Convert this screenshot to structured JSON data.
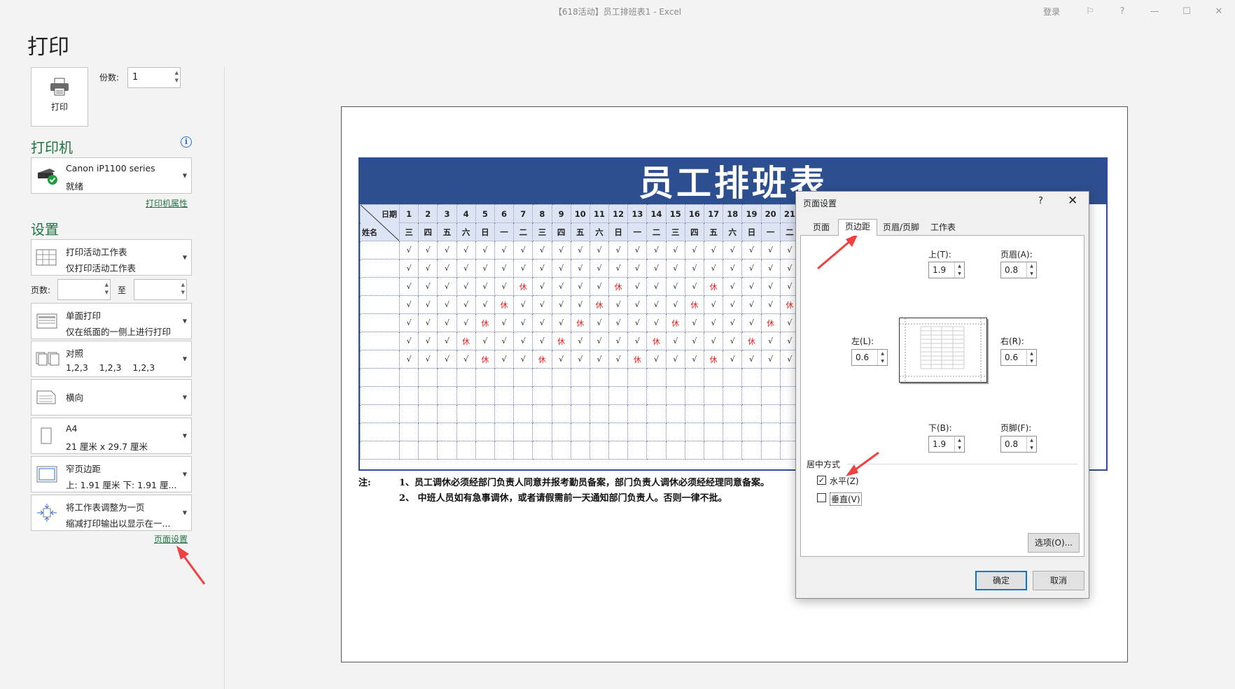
{
  "window": {
    "title": "【618活动】员工排班表1  -  Excel",
    "login": "登录"
  },
  "heading": "打印",
  "print_button": {
    "label": "打印"
  },
  "copies": {
    "label": "份数:",
    "value": "1"
  },
  "printer": {
    "section": "打印机",
    "name": "Canon iP1100 series",
    "status": "就绪",
    "properties_link": "打印机属性"
  },
  "settings": {
    "section": "设置",
    "items": [
      {
        "l1": "打印活动工作表",
        "l2": "仅打印活动工作表",
        "icon": "sheet-icon"
      },
      {
        "l1": "单面打印",
        "l2": "仅在纸面的一侧上进行打印",
        "icon": "one-sided-icon"
      },
      {
        "l1": "对照",
        "l2": "1,2,3    1,2,3    1,2,3",
        "icon": "collate-icon"
      },
      {
        "l1": "横向",
        "l2": "",
        "icon": "landscape-icon"
      },
      {
        "l1": "A4",
        "l2": "21 厘米 x 29.7 厘米",
        "icon": "paper-size-icon"
      },
      {
        "l1": "窄页边距",
        "l2": "上: 1.91 厘米 下: 1.91 厘...",
        "icon": "margins-icon"
      },
      {
        "l1": "将工作表调整为一页",
        "l2": "缩减打印输出以显示在一...",
        "icon": "scaling-icon"
      }
    ],
    "pages_label": "页数:",
    "to_label": "至",
    "page_setup_link": "页面设置"
  },
  "sheet": {
    "title": "员工排班表",
    "date_label": "日期",
    "name_label": "姓名",
    "days": [
      "1",
      "2",
      "3",
      "4",
      "5",
      "6",
      "7",
      "8",
      "9",
      "10",
      "11",
      "12",
      "13",
      "14",
      "15",
      "16",
      "17",
      "18",
      "19",
      "20",
      "21"
    ],
    "weekdays": [
      "三",
      "四",
      "五",
      "六",
      "日",
      "一",
      "二",
      "三",
      "四",
      "五",
      "六",
      "日",
      "一",
      "二",
      "三",
      "四",
      "五",
      "六",
      "日",
      "一",
      "二"
    ],
    "rows": [
      [
        "√",
        "√",
        "√",
        "√",
        "√",
        "√",
        "√",
        "√",
        "√",
        "√",
        "√",
        "√",
        "√",
        "√",
        "√",
        "√",
        "√",
        "√",
        "√",
        "√",
        "√"
      ],
      [
        "√",
        "√",
        "√",
        "√",
        "√",
        "√",
        "√",
        "√",
        "√",
        "√",
        "√",
        "√",
        "√",
        "√",
        "√",
        "√",
        "√",
        "√",
        "√",
        "√",
        "√"
      ],
      [
        "√",
        "√",
        "√",
        "√",
        "√",
        "√",
        "休",
        "√",
        "√",
        "√",
        "√",
        "休",
        "√",
        "√",
        "√",
        "√",
        "休",
        "√",
        "√",
        "√",
        "√"
      ],
      [
        "√",
        "√",
        "√",
        "√",
        "√",
        "休",
        "√",
        "√",
        "√",
        "√",
        "休",
        "√",
        "√",
        "√",
        "√",
        "休",
        "√",
        "√",
        "√",
        "√",
        "休"
      ],
      [
        "√",
        "√",
        "√",
        "√",
        "休",
        "√",
        "√",
        "√",
        "√",
        "休",
        "√",
        "√",
        "√",
        "√",
        "休",
        "√",
        "√",
        "√",
        "√",
        "休",
        "√"
      ],
      [
        "√",
        "√",
        "√",
        "休",
        "√",
        "√",
        "√",
        "√",
        "休",
        "√",
        "√",
        "√",
        "√",
        "休",
        "√",
        "√",
        "√",
        "√",
        "休",
        "√",
        "√"
      ],
      [
        "√",
        "√",
        "√",
        "√",
        "休",
        "√",
        "√",
        "休",
        "√",
        "√",
        "√",
        "√",
        "休",
        "√",
        "√",
        "√",
        "休",
        "√",
        "√",
        "√",
        "√"
      ],
      [
        "",
        "",
        "",
        "",
        "",
        "",
        "",
        "",
        "",
        "",
        "",
        "",
        "",
        "",
        "",
        "",
        "",
        "",
        "",
        "",
        ""
      ],
      [
        "",
        "",
        "",
        "",
        "",
        "",
        "",
        "",
        "",
        "",
        "",
        "",
        "",
        "",
        "",
        "",
        "",
        "",
        "",
        "",
        ""
      ],
      [
        "",
        "",
        "",
        "",
        "",
        "",
        "",
        "",
        "",
        "",
        "",
        "",
        "",
        "",
        "",
        "",
        "",
        "",
        "",
        "",
        ""
      ],
      [
        "",
        "",
        "",
        "",
        "",
        "",
        "",
        "",
        "",
        "",
        "",
        "",
        "",
        "",
        "",
        "",
        "",
        "",
        "",
        "",
        ""
      ],
      [
        "",
        "",
        "",
        "",
        "",
        "",
        "",
        "",
        "",
        "",
        "",
        "",
        "",
        "",
        "",
        "",
        "",
        "",
        "",
        "",
        ""
      ]
    ],
    "rest_mark": "休",
    "notes_label": "注:",
    "notes": [
      "1、员工调休必须经部门负责人同意并报考勤员备案，部门负责人调休必须经经理同意备案。",
      "2、 中班人员如有急事调休，或者请假需前一天通知部门负责人。否则一律不批。"
    ]
  },
  "dialog": {
    "title": "页面设置",
    "help": "?",
    "close": "✕",
    "tabs": [
      "页面",
      "页边距",
      "页眉/页脚",
      "工作表"
    ],
    "active_tab": 1,
    "top": {
      "label": "上(T):",
      "value": "1.9"
    },
    "header": {
      "label": "页眉(A):",
      "value": "0.8"
    },
    "left": {
      "label": "左(L):",
      "value": "0.6"
    },
    "right": {
      "label": "右(R):",
      "value": "0.6"
    },
    "bottom": {
      "label": "下(B):",
      "value": "1.9"
    },
    "footer": {
      "label": "页脚(F):",
      "value": "0.8"
    },
    "center_group": "居中方式",
    "horizontal": {
      "label": "水平(Z)",
      "checked": true
    },
    "vertical": {
      "label": "垂直(V)",
      "checked": false
    },
    "options_button": "选项(O)...",
    "ok_button": "确定",
    "cancel_button": "取消"
  },
  "colors": {
    "accent": "#217346",
    "sheet_blue": "#2e4f8f",
    "annotation_red": "#f04040"
  }
}
